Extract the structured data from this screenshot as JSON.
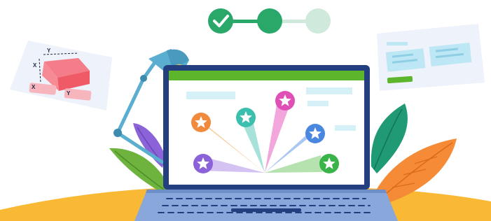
{
  "progress": {
    "total_steps": 3,
    "current_step": 2,
    "steps": [
      {
        "state": "completed",
        "icon": "check-icon",
        "color": "#2aa86a"
      },
      {
        "state": "current",
        "color": "#2aa86a"
      },
      {
        "state": "upcoming",
        "color": "#cfe9dc"
      }
    ]
  },
  "diagram": {
    "x_axis_label": "X",
    "y_axis_label": "Y",
    "x_chip_label": "X",
    "y_chip_label": "Y"
  },
  "laptop": {
    "header_color": "#5cb52b",
    "stars": [
      {
        "color": "#f08a3c"
      },
      {
        "color": "#3cbfae"
      },
      {
        "color": "#e04fb5"
      },
      {
        "color": "#4a87e0"
      },
      {
        "color": "#8c62d8"
      },
      {
        "color": "#39b449"
      }
    ]
  },
  "colors": {
    "lamp": "#5aaecf",
    "desk": "#f9b934",
    "laptop_body": "#233f7f",
    "keyboard": "#8aa7dc"
  }
}
